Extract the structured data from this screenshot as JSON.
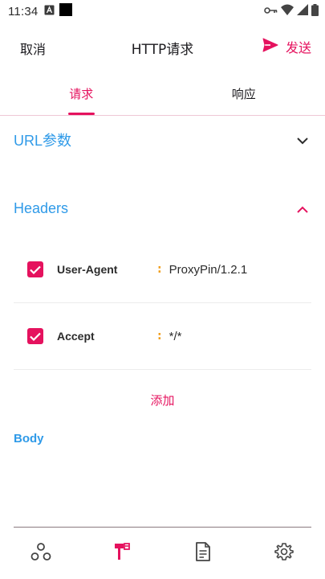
{
  "status_bar": {
    "time": "11:34"
  },
  "app_bar": {
    "cancel_label": "取消",
    "title": "HTTP请求",
    "send_label": "发送"
  },
  "tabs": [
    {
      "label": "请求",
      "active": true
    },
    {
      "label": "响应",
      "active": false
    }
  ],
  "sections": {
    "url_params": "URL参数",
    "headers": "Headers",
    "body": "Body"
  },
  "headers": [
    {
      "name": "User-Agent",
      "value": "ProxyPin/1.2.1",
      "enabled": true
    },
    {
      "name": "Accept",
      "value": "*/*",
      "enabled": true
    }
  ],
  "colon": ":",
  "add_label": "添加",
  "bottom_nav": [
    {
      "icon": "nodes-icon",
      "active": false
    },
    {
      "icon": "toolbox-icon",
      "active": true
    },
    {
      "icon": "document-icon",
      "active": false
    },
    {
      "icon": "settings-icon",
      "active": false
    }
  ],
  "colors": {
    "accent": "#e5125e",
    "section_blue": "#2f9ae8",
    "colon_orange": "#f0a020"
  }
}
